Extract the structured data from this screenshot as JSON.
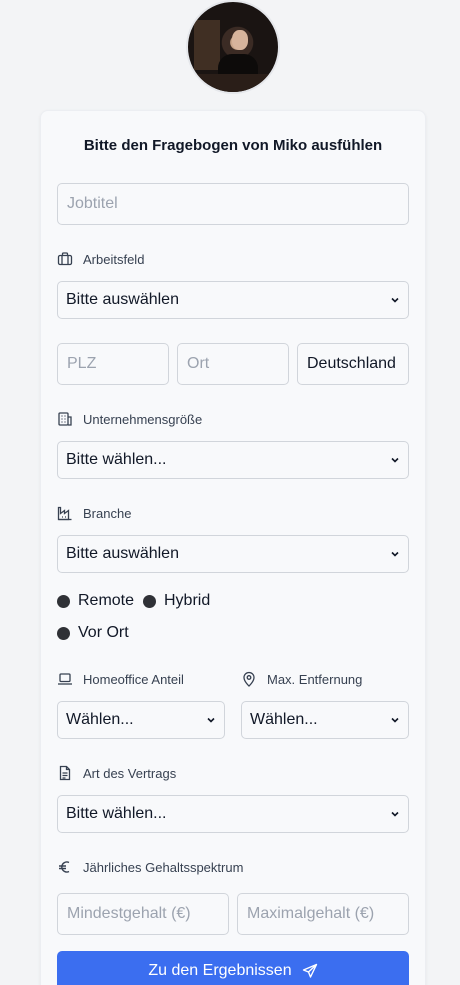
{
  "form": {
    "title": "Bitte den Fragebogen von Miko ausfühlen",
    "job_title_placeholder": "Jobtitel",
    "arbeitsfeld_label": "Arbeitsfeld",
    "arbeitsfeld_value": "Bitte auswählen",
    "plz_placeholder": "PLZ",
    "ort_placeholder": "Ort",
    "country_value": "Deutschland",
    "size_label": "Unternehmensgröße",
    "size_value": "Bitte wählen...",
    "branche_label": "Branche",
    "branche_value": "Bitte auswählen",
    "work_modes": [
      "Remote",
      "Hybrid",
      "Vor Ort"
    ],
    "homeoffice_label": "Homeoffice Anteil",
    "homeoffice_value": "Wählen...",
    "distance_label": "Max. Entfernung",
    "distance_value": "Wählen...",
    "contract_label": "Art des Vertrags",
    "contract_value": "Bitte wählen...",
    "salary_label": "Jährliches Gehaltsspektrum",
    "salary_min_placeholder": "Mindestgehalt (€)",
    "salary_max_placeholder": "Maximalgehalt (€)",
    "submit_label": "Zu den Ergebnissen"
  },
  "icons": {
    "briefcase": "briefcase-icon",
    "building": "building-icon",
    "industry": "factory-icon",
    "laptop": "laptop-icon",
    "location": "map-pin-icon",
    "document": "document-icon",
    "euro": "euro-icon",
    "send": "send-icon"
  },
  "colors": {
    "primary": "#3b6ef0",
    "background": "#f3f4f6"
  }
}
